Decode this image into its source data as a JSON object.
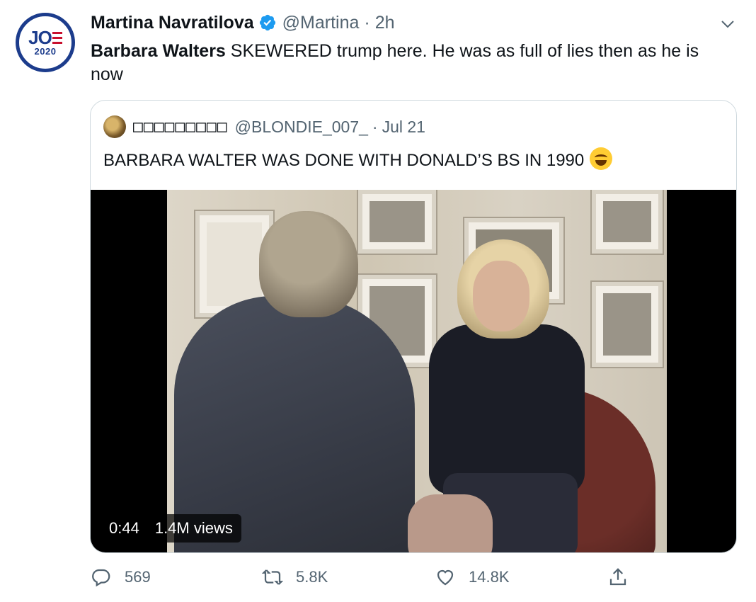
{
  "author": {
    "name": "Martina Navratilova",
    "handle": "@Martina",
    "separator": "·",
    "time": "2h",
    "avatar": {
      "line1": "JO",
      "line2": "2020",
      "colors": {
        "blue": "#1c3c8c",
        "red": "#c8102e"
      }
    },
    "verified_icon": "verified-badge-icon"
  },
  "tweet": {
    "bold_text": "Barbara Walters",
    "text": " SKEWERED trump here. He was as full of lies then as he is now"
  },
  "quote": {
    "name": "□□□□□□□□□",
    "handle": "@BLONDIE_007_",
    "separator": "·",
    "date": "Jul 21",
    "text": "BARBARA WALTER WAS DONE WITH DONALD’S BS IN 1990",
    "emoji_icon": "face-with-tears-of-joy-icon",
    "video": {
      "duration": "0:44",
      "views": "1.4M views"
    }
  },
  "actions": {
    "reply_count": "569",
    "retweet_count": "5.8K",
    "like_count": "14.8K"
  },
  "colors": {
    "text": "#0f1419",
    "secondary": "#536471",
    "border": "#cfd9de",
    "verified": "#1d9bf0"
  }
}
